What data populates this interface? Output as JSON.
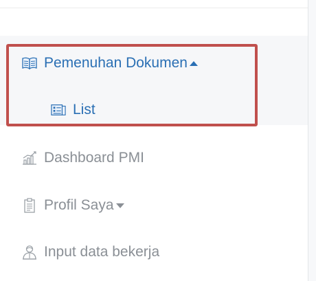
{
  "sidebar": {
    "items": [
      {
        "label": "Pemenuhan Dokumen",
        "icon": "book-icon",
        "expanded": true,
        "active": true
      },
      {
        "label": "List",
        "icon": "list-icon",
        "active": true
      },
      {
        "label": "Dashboard PMI",
        "icon": "chart-icon",
        "active": false
      },
      {
        "label": "Profil Saya",
        "icon": "clipboard-icon",
        "expanded": false,
        "active": false
      },
      {
        "label": "Input data bekerja",
        "icon": "user-icon",
        "active": false
      }
    ]
  },
  "colors": {
    "active_text": "#2a6fb4",
    "inactive_text": "#8a8f95",
    "highlight_border": "#c0504d",
    "active_background": "#f6f7f9"
  }
}
